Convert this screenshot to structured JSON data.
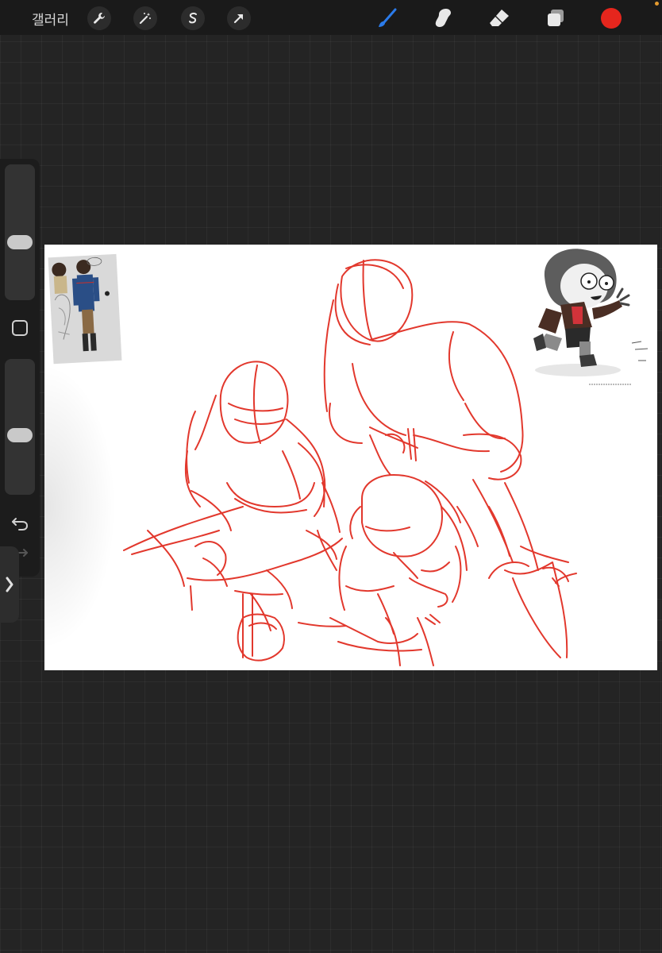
{
  "toolbar": {
    "gallery_label": "갤러리",
    "left_tools": [
      "wrench-icon",
      "magic-wand-icon",
      "selection-s-icon",
      "transform-arrow-icon"
    ],
    "right_tools": [
      "brush-icon",
      "smudge-icon",
      "eraser-icon",
      "layers-icon",
      "color-swatch"
    ],
    "active_tool": "brush",
    "brush_color": "#2b7bea",
    "current_color": "#e5261d"
  },
  "sidebar": {
    "brush_size_level": 0.58,
    "opacity_level": 0.57,
    "modify_button": "square-modify-icon",
    "undo": "undo-icon",
    "redo": "redo-icon",
    "expand": "chevron-right-icon"
  },
  "canvas": {
    "background": "#ffffff",
    "sketch_color": "#e0281c",
    "references": [
      "reference-image-two-figures",
      "reference-image-running-girl"
    ]
  }
}
